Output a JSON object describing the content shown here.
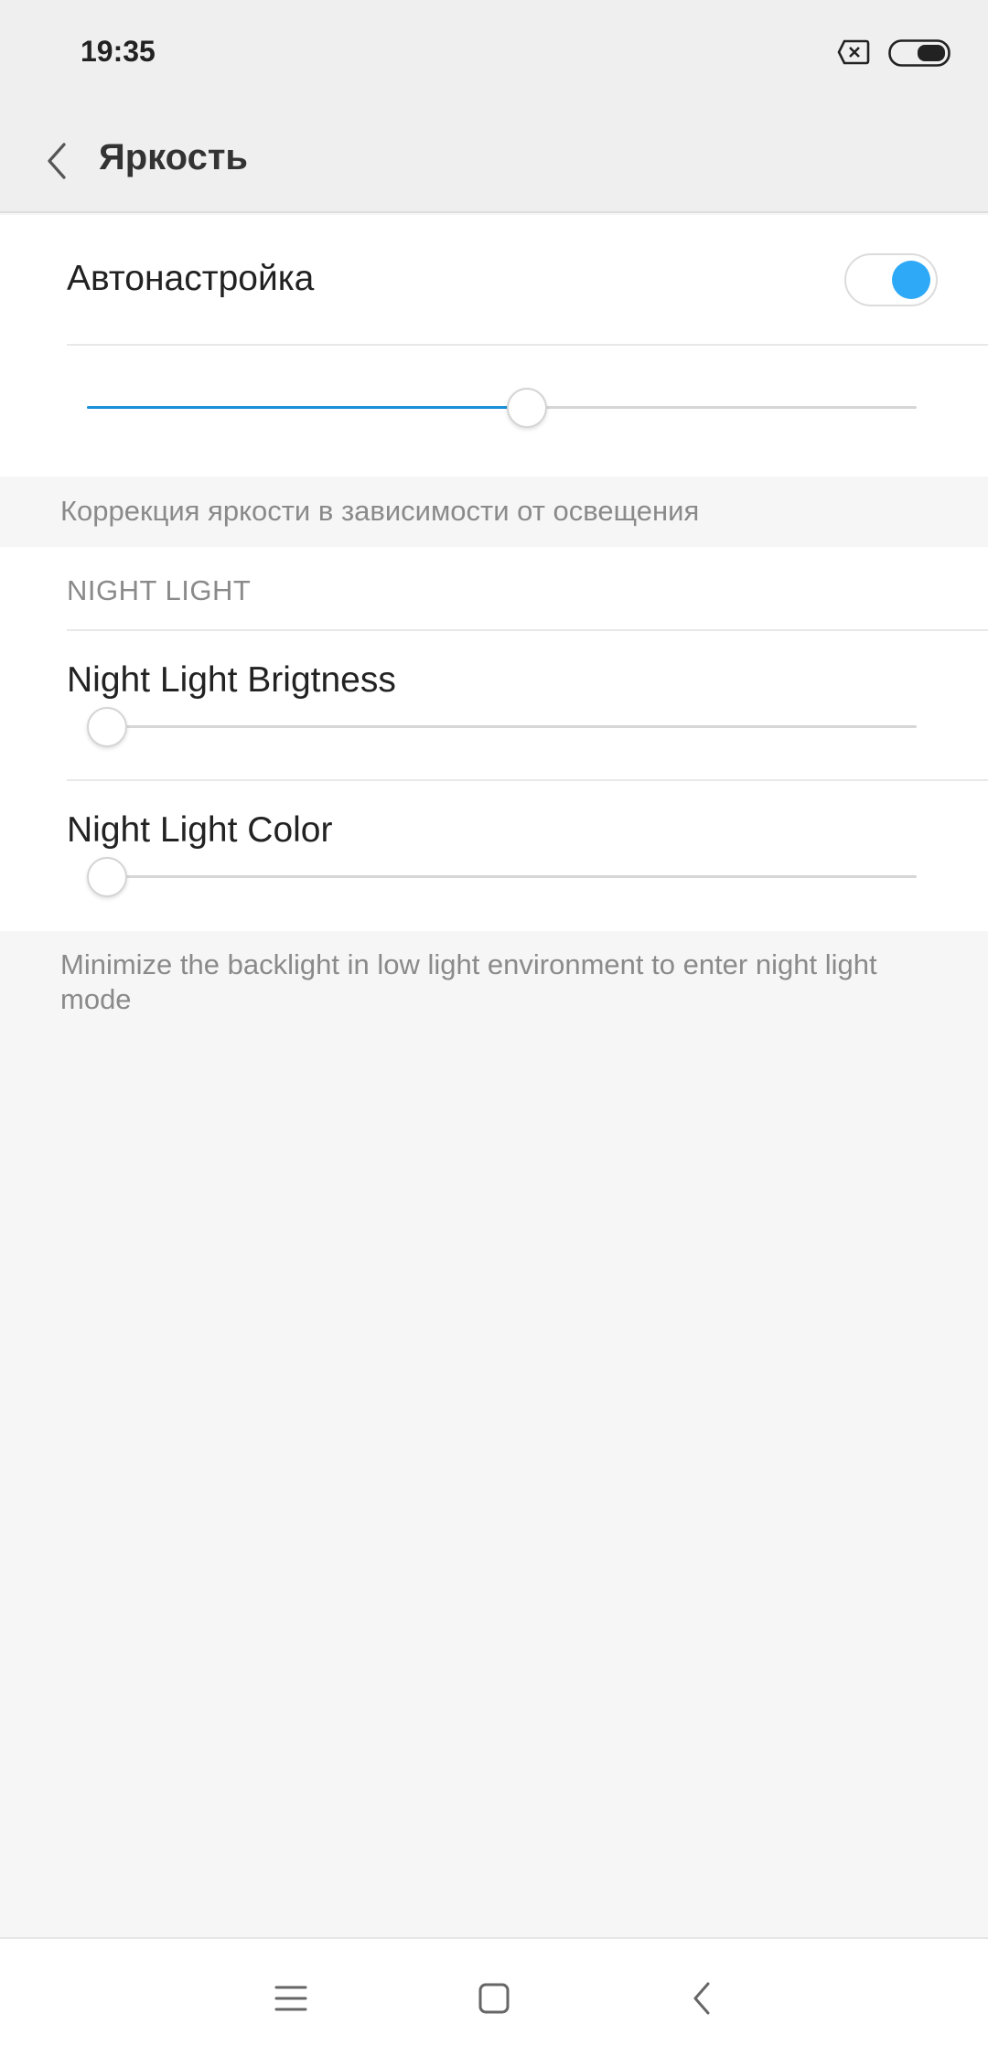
{
  "status_bar": {
    "time": "19:35",
    "icons": [
      "sim-off-icon",
      "battery-icon"
    ]
  },
  "header": {
    "back_icon": "chevron-left-icon",
    "title": "Яркость"
  },
  "brightness": {
    "auto_label": "Автонастройка",
    "auto_enabled": true,
    "level_percent": 53,
    "footnote": "Коррекция яркости в зависимости от освещения"
  },
  "night_light": {
    "section_title": "NIGHT LIGHT",
    "brightness_label": "Night Light Brigtness",
    "brightness_percent": 1,
    "color_label": "Night Light Color",
    "color_percent": 1,
    "footnote": "Minimize the backlight in low light environment to enter night light mode"
  },
  "nav_bar": {
    "icons": [
      "menu-icon",
      "home-icon",
      "back-icon"
    ]
  },
  "colors": {
    "accent": "#2ea9f7",
    "slider_fill": "#1a90d9"
  }
}
